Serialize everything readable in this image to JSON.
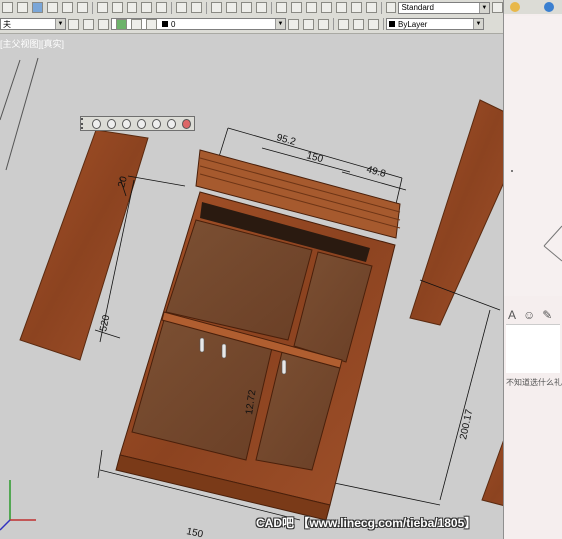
{
  "toolbar": {
    "layer_value": "0",
    "layer_prefix_fragment": "夫",
    "text_style": "Standard",
    "color_value": "ByLayer"
  },
  "viewport": {
    "view_label": "[主父视图][真实]"
  },
  "dimensions": {
    "d_95_2": "95.2",
    "d_150_top": "150",
    "d_49_8": "49.8",
    "d_20": "20",
    "d_520": "520",
    "d_12_72": "12.72",
    "d_200_17": "200.17",
    "d_150_bottom": "150"
  },
  "right_panel": {
    "hint_text": "不知道选什么礼"
  },
  "watermark": {
    "text": "CAD吧 【www.linecg.com/tieba/1805】"
  },
  "colors": {
    "wood": "#9c4a22",
    "wood_dark": "#6e3516",
    "interior": "#7a4a2c",
    "viewport_bg": "#cdcdcd"
  }
}
